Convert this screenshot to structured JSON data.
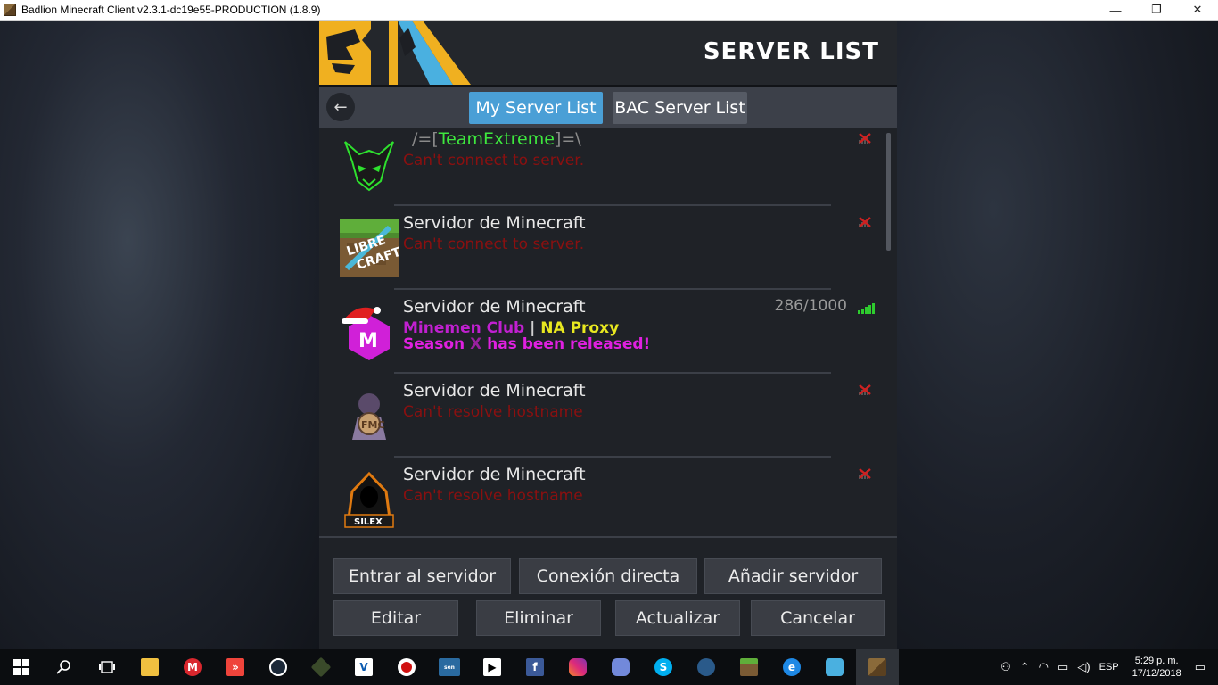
{
  "window": {
    "title": "Badlion Minecraft Client v2.3.1-dc19e55-PRODUCTION (1.8.9)",
    "controls": {
      "minimize": "—",
      "maximize": "❐",
      "close": "✕"
    }
  },
  "header": {
    "title": "SERVER LIST"
  },
  "tabs": {
    "back": "←",
    "my_list": "My Server List",
    "bac_list": "BAC Server List"
  },
  "servers": [
    {
      "name_prefix": "/=[",
      "name_core": "TeamExtreme",
      "name_suffix": "]=\\",
      "motd": "Can't connect to server.",
      "status": "error"
    },
    {
      "name": "Servidor de Minecraft",
      "motd": "Can't connect to server.",
      "status": "error"
    },
    {
      "name": "Servidor de Minecraft",
      "players": "286/1000",
      "motd_part1": "Minemen Club",
      "motd_sep": "|",
      "motd_part2": "NA Proxy",
      "motd2_a": "Season ",
      "motd2_b": "X",
      "motd2_c": " has been released!",
      "status": "online"
    },
    {
      "name": "Servidor de Minecraft",
      "motd": "Can't resolve hostname",
      "status": "error"
    },
    {
      "name": "Servidor de Minecraft",
      "motd": "Can't resolve hostname",
      "status": "error"
    }
  ],
  "buttons": {
    "join": "Entrar al servidor",
    "direct": "Conexión directa",
    "add": "Añadir servidor",
    "edit": "Editar",
    "delete": "Eliminar",
    "refresh": "Actualizar",
    "cancel": "Cancelar"
  },
  "taskbar": {
    "language": "ESP",
    "time": "5:29 p. m.",
    "date": "17/12/2018"
  },
  "colors": {
    "accent": "#4a9fd6",
    "error": "#8a1010",
    "team_green": "#3ee83e",
    "minemen_purple": "#c020d0",
    "proxy_yellow": "#e8e820",
    "signal_green": "#2ecc2e"
  }
}
